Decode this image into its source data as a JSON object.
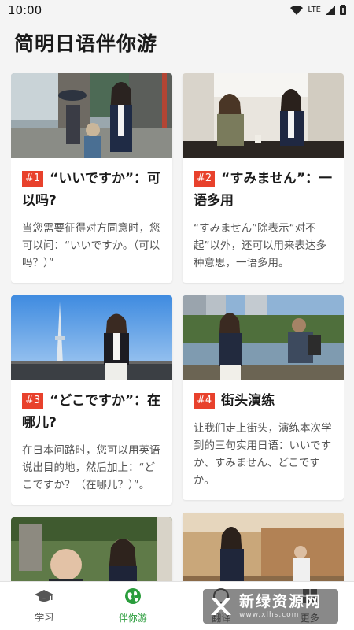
{
  "status_bar": {
    "time": "10:00",
    "network": "LTE"
  },
  "header": {
    "title": "简明日语伴你游"
  },
  "cards": [
    {
      "num": "#1",
      "title": "“いいですか”：可以吗?",
      "desc": "当您需要征得对方同意时，您可以问：“いいですか。（可以吗？）”"
    },
    {
      "num": "#2",
      "title": "“すみません”：一语多用",
      "desc": "“すみません”除表示“对不起”以外，还可以用来表达多种意思，一语多用。"
    },
    {
      "num": "#3",
      "title": "“どこですか”：在哪儿?",
      "desc": "在日本问路时，您可以用英语说出目的地，然后加上：“どこですか？（在哪儿？）”。"
    },
    {
      "num": "#4",
      "title": "街头演练",
      "desc": "让我们走上街头，演练本次学到的三句实用日语：いいですか、すみません、どこですか。"
    }
  ],
  "bottom_nav": [
    {
      "label": "学习",
      "icon": "graduation-cap-icon"
    },
    {
      "label": "伴你游",
      "icon": "globe-icon"
    },
    {
      "label": "翻译",
      "icon": "translate-icon"
    },
    {
      "label": "更多",
      "icon": "more-icon"
    }
  ],
  "watermark": {
    "main": "新绿资源网",
    "sub": "www.xlhs.com"
  },
  "colors": {
    "accent_red": "#e8412c",
    "active_green": "#2a9d3c"
  }
}
